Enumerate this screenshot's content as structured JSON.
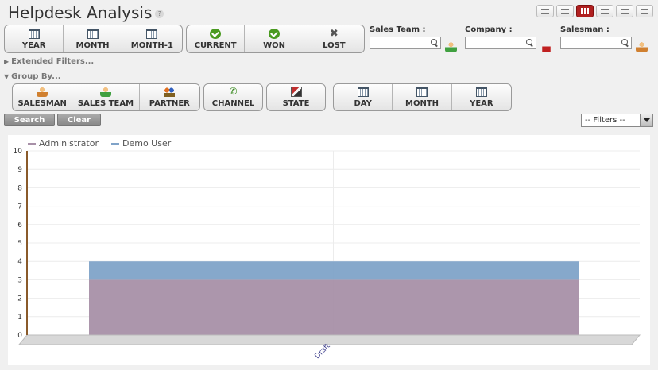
{
  "page": {
    "title": "Helpdesk Analysis",
    "help": "?"
  },
  "view_modes": [
    "list",
    "page",
    "graph",
    "calendar",
    "gantt",
    "kanban"
  ],
  "period_filters": [
    {
      "label": "YEAR",
      "icon": "calendar-icon"
    },
    {
      "label": "MONTH",
      "icon": "calendar-icon"
    },
    {
      "label": "MONTH-1",
      "icon": "calendar-icon"
    }
  ],
  "state_filters": [
    {
      "label": "CURRENT",
      "icon": "check-icon"
    },
    {
      "label": "WON",
      "icon": "check-icon"
    },
    {
      "label": "LOST",
      "icon": "cross-icon"
    }
  ],
  "fields": {
    "sales_team": {
      "label": "Sales Team :",
      "value": ""
    },
    "company": {
      "label": "Company :",
      "value": ""
    },
    "salesman": {
      "label": "Salesman :",
      "value": ""
    }
  },
  "extended_filters": {
    "label": "Extended Filters...",
    "collapsed": true
  },
  "group_by": {
    "label": "Group By...",
    "people": [
      {
        "label": "SALESMAN",
        "icon": "user-icon"
      },
      {
        "label": "SALES TEAM",
        "icon": "team-icon"
      },
      {
        "label": "PARTNER",
        "icon": "partner-icon"
      }
    ],
    "channel": {
      "label": "CHANNEL",
      "icon": "phone-icon"
    },
    "state": {
      "label": "STATE",
      "icon": "state-icon"
    },
    "dates": [
      {
        "label": "DAY",
        "icon": "calendar-icon"
      },
      {
        "label": "MONTH",
        "icon": "calendar-icon"
      },
      {
        "label": "YEAR",
        "icon": "calendar-icon"
      }
    ]
  },
  "actions": {
    "search": "Search",
    "clear": "Clear"
  },
  "filters_select": {
    "value": "-- Filters --"
  },
  "colors": {
    "administrator": "#a890a8",
    "demo_user": "#80a3c8"
  },
  "chart_data": {
    "type": "area",
    "stacked": true,
    "categories": [
      "Draft"
    ],
    "series": [
      {
        "name": "Administrator",
        "values": [
          3
        ],
        "color": "#a890a8"
      },
      {
        "name": "Demo User",
        "values": [
          1
        ],
        "color": "#80a3c8"
      }
    ],
    "ylim": [
      0,
      10
    ],
    "yticks": [
      0,
      1,
      2,
      3,
      4,
      5,
      6,
      7,
      8,
      9,
      10
    ],
    "grid": true,
    "legend": "top-left"
  }
}
